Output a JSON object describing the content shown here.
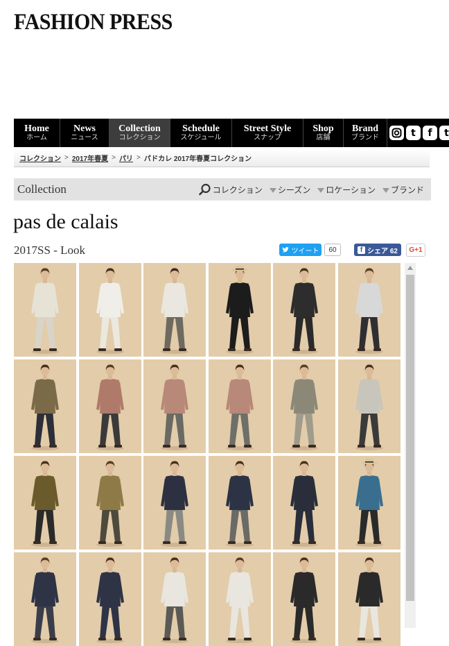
{
  "site": {
    "logo": "FASHION PRESS"
  },
  "nav": [
    {
      "en": "Home",
      "jp": "ホーム"
    },
    {
      "en": "News",
      "jp": "ニュース"
    },
    {
      "en": "Collection",
      "jp": "コレクション"
    },
    {
      "en": "Schedule",
      "jp": "スケジュール"
    },
    {
      "en": "Street Style",
      "jp": "スナップ"
    },
    {
      "en": "Shop",
      "jp": "店舗"
    },
    {
      "en": "Brand",
      "jp": "ブランド"
    }
  ],
  "social_icons": [
    "instagram-icon",
    "tumblr-icon",
    "facebook-icon",
    "twitter-icon"
  ],
  "breadcrumb": {
    "links": [
      "コレクション",
      "2017年春夏",
      "パリ"
    ],
    "separator": ">",
    "current": "パドカレ 2017年春夏コレクション"
  },
  "collection_bar": {
    "title": "Collection",
    "search_label": "コレクション",
    "filters": [
      "シーズン",
      "ロケーション",
      "ブランド"
    ]
  },
  "page": {
    "brand": "pas de calais",
    "subtitle": "2017SS - Look"
  },
  "share": {
    "tweet_label": "ツイート",
    "tweet_count": "60",
    "fb_label": "シェア 62",
    "gplus_label": "G+1"
  },
  "colors": {
    "nav_bg": "#000000",
    "nav_active": "#3d3d3d",
    "backdrop": "#e3ccaa",
    "twitter": "#1da1f2",
    "facebook": "#3b5998"
  },
  "looks": [
    {
      "top": "#e6e2d6",
      "bottom": "#d8d4c8",
      "hair": "#5a3b26",
      "hat": false
    },
    {
      "top": "#f0eee8",
      "bottom": "#ebe8e0",
      "hair": "#4a2e1c",
      "hat": false
    },
    {
      "top": "#e9e7df",
      "bottom": "#6e6a60",
      "hair": "#3c2a20",
      "hat": false
    },
    {
      "top": "#1c1c1c",
      "bottom": "#1c1c1c",
      "hair": "#4a2e1c",
      "hat": true
    },
    {
      "top": "#2d2d2d",
      "bottom": "#2a2a2a",
      "hair": "#4a2e1c",
      "hat": false
    },
    {
      "top": "#d8d8d8",
      "bottom": "#2f2f33",
      "hair": "#5a3b26",
      "hat": false
    },
    {
      "top": "#7a6a48",
      "bottom": "#2c2f38",
      "hair": "#4a2e1c",
      "hat": false
    },
    {
      "top": "#b07a6a",
      "bottom": "#3a3a3a",
      "hair": "#5a3b26",
      "hat": false
    },
    {
      "top": "#b88878",
      "bottom": "#6a6a64",
      "hair": "#4a2e1c",
      "hat": false
    },
    {
      "top": "#b88878",
      "bottom": "#6f6f6a",
      "hair": "#4a2e1c",
      "hat": false
    },
    {
      "top": "#8b8878",
      "bottom": "#a09c8c",
      "hair": "#5a3b26",
      "hat": false
    },
    {
      "top": "#c8c6bc",
      "bottom": "#3a3a3a",
      "hair": "#4a2e1c",
      "hat": false
    },
    {
      "top": "#6a5a2c",
      "bottom": "#2a2a2a",
      "hair": "#4a2e1c",
      "hat": false
    },
    {
      "top": "#8e7a46",
      "bottom": "#4e4a3c",
      "hair": "#5a3b26",
      "hat": false
    },
    {
      "top": "#2c3040",
      "bottom": "#8a8a84",
      "hair": "#4a2e1c",
      "hat": false
    },
    {
      "top": "#2c3344",
      "bottom": "#6a6a66",
      "hair": "#4a2e1c",
      "hat": false
    },
    {
      "top": "#2a2e3a",
      "bottom": "#2a2e3a",
      "hair": "#4a2e1c",
      "hat": false
    },
    {
      "top": "#3a6e8e",
      "bottom": "#2a2a2a",
      "hair": "#4a2e1c",
      "hat": true
    },
    {
      "top": "#2e3446",
      "bottom": "#3a3e4a",
      "hair": "#5a3b26",
      "hat": false
    },
    {
      "top": "#2e3446",
      "bottom": "#2e3446",
      "hair": "#4a2e1c",
      "hat": false
    },
    {
      "top": "#e8e6de",
      "bottom": "#5a5a56",
      "hair": "#4a2e1c",
      "hat": false
    },
    {
      "top": "#e8e6de",
      "bottom": "#e8e6de",
      "hair": "#5a3b26",
      "hat": false
    },
    {
      "top": "#2a2a2a",
      "bottom": "#2a2a2a",
      "hair": "#4a2e1c",
      "hat": false
    },
    {
      "top": "#2a2a2a",
      "bottom": "#e8e6de",
      "hair": "#4a2e1c",
      "hat": false
    }
  ]
}
